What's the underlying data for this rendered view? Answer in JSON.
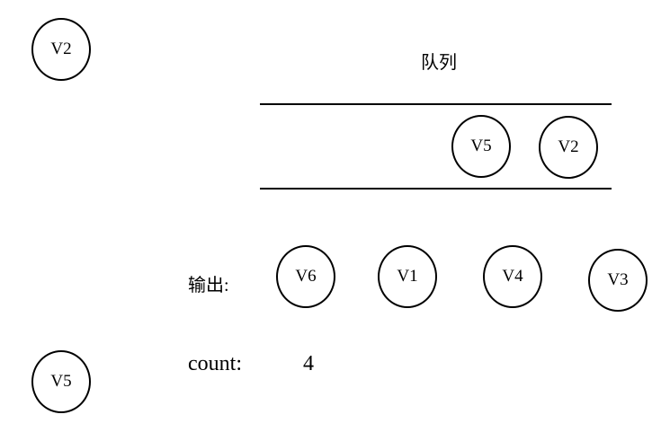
{
  "graph_nodes": [
    "V2",
    "V5"
  ],
  "queue": {
    "title": "队列",
    "items": [
      "V5",
      "V2"
    ]
  },
  "output": {
    "label": "输出:",
    "items": [
      "V6",
      "V1",
      "V4",
      "V3"
    ]
  },
  "count": {
    "label": "count:",
    "value": "4"
  }
}
